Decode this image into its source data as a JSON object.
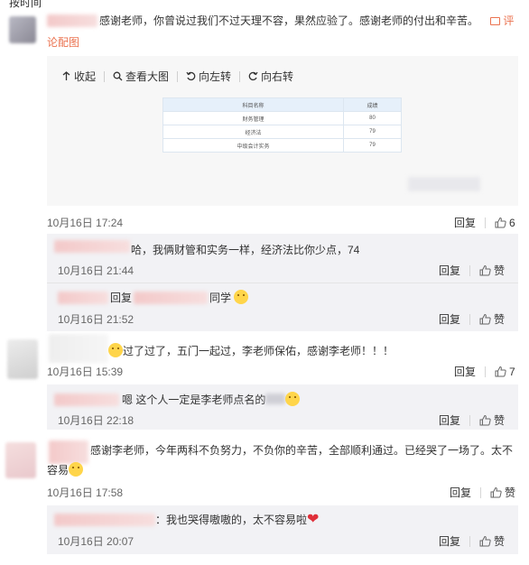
{
  "top_cut": "按时间",
  "main_comment": {
    "text": "感谢老师，你曾说过我们不过天理不容，果然应验了。感谢老师的付出和辛苦。",
    "pic_link": "评论配图",
    "pic_link_line2": "论配图",
    "time": "10月16日 17:24",
    "reply_label": "回复",
    "like_count": "6"
  },
  "image_toolbar": {
    "collapse": "收起",
    "view_large": "查看大图",
    "rotate_left": "向左转",
    "rotate_right": "向右转"
  },
  "score_table": {
    "headers": [
      "科目名称",
      "成绩"
    ],
    "rows": [
      [
        "财务管理",
        "80"
      ],
      [
        "经济法",
        "79"
      ],
      [
        "中级会计实务",
        "79"
      ]
    ]
  },
  "replies_1": [
    {
      "text": "哈，我俩财管和实务一样，经济法比你少点，74",
      "time": "10月16日 21:44",
      "reply_label": "回复",
      "like_label": "赞"
    },
    {
      "prefix": "回复",
      "text": "同学",
      "time": "10月16日 21:52",
      "reply_label": "回复",
      "like_label": "赞"
    }
  ],
  "comment_2": {
    "text": "过了过了，五门一起过，李老师保佑，感谢李老师！！！",
    "time": "10月16日 15:39",
    "reply_label": "回复",
    "like_count": "7"
  },
  "replies_2": [
    {
      "text": "嗯 这个人一定是李老师点名的",
      "time": "10月16日 22:18",
      "reply_label": "回复",
      "like_label": "赞"
    }
  ],
  "comment_3": {
    "text_line1": "感谢李老师，今年两科不负努力，不负你的辛苦，全部顺利通过。已经哭了一场了。太不",
    "text_line2": "容易",
    "time": "10月16日 17:58",
    "reply_label": "回复",
    "like_label": "赞"
  },
  "replies_3": [
    {
      "text": "：我也哭得嗷嗷的，太不容易啦",
      "time": "10月16日 20:07",
      "reply_label": "回复",
      "like_label": "赞"
    }
  ]
}
